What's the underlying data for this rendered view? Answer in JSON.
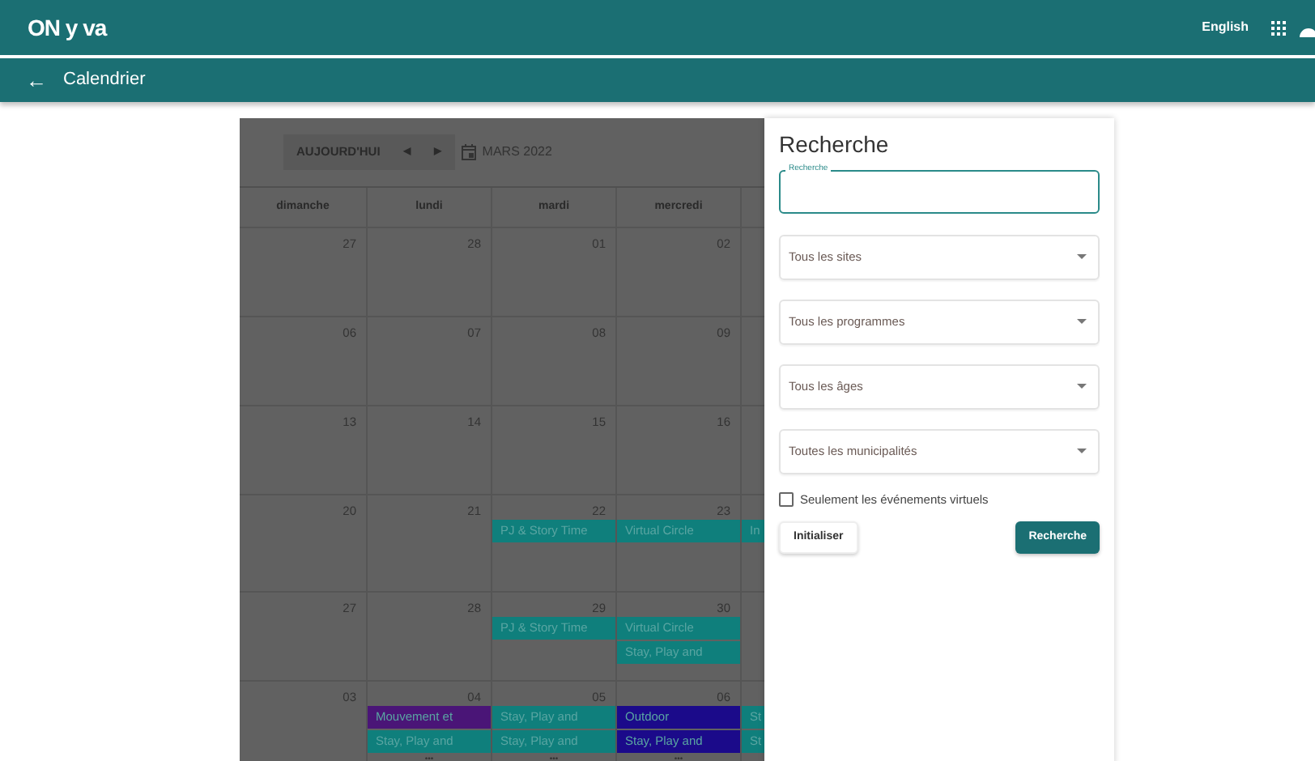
{
  "header": {
    "logo": "ON y va",
    "language": "English"
  },
  "subbar": {
    "back": "←",
    "title": "Calendrier"
  },
  "calendar": {
    "today_button": "AUJOURD'HUI",
    "prev": "◀",
    "next": "▶",
    "month_label": "MARS 2022",
    "weekdays": [
      "dimanche",
      "lundi",
      "mardi",
      "mercredi"
    ],
    "weeks": [
      {
        "days": [
          {
            "date": "27"
          },
          {
            "date": "28"
          },
          {
            "date": "01"
          },
          {
            "date": "02"
          }
        ]
      },
      {
        "days": [
          {
            "date": "06"
          },
          {
            "date": "07"
          },
          {
            "date": "08"
          },
          {
            "date": "09"
          }
        ]
      },
      {
        "days": [
          {
            "date": "13"
          },
          {
            "date": "14"
          },
          {
            "date": "15"
          },
          {
            "date": "16"
          }
        ]
      },
      {
        "days": [
          {
            "date": "20"
          },
          {
            "date": "21"
          },
          {
            "date": "22",
            "events": [
              {
                "title": "PJ & Story Time",
                "color": "#0f7f7c"
              }
            ]
          },
          {
            "date": "23",
            "events": [
              {
                "title": "Virtual Circle",
                "color": "#0f7f7c"
              }
            ]
          },
          {
            "events": [
              {
                "title": "In",
                "color": "#0f7f7c"
              }
            ]
          }
        ]
      },
      {
        "days": [
          {
            "date": "27"
          },
          {
            "date": "28"
          },
          {
            "date": "29",
            "events": [
              {
                "title": "PJ & Story Time",
                "color": "#0f7f7c"
              }
            ]
          },
          {
            "date": "30",
            "events": [
              {
                "title": "Virtual Circle",
                "color": "#0f7f7c"
              },
              {
                "title": "Stay, Play and",
                "color": "#0f7f7c"
              }
            ]
          }
        ]
      },
      {
        "days": [
          {
            "date": "03"
          },
          {
            "date": "04",
            "events": [
              {
                "title": "Mouvement et",
                "color": "#4a1577"
              },
              {
                "title": "Stay, Play and",
                "color": "#0f7f7c"
              }
            ],
            "more": "•••"
          },
          {
            "date": "05",
            "events": [
              {
                "title": "Stay, Play and",
                "color": "#0f7f7c"
              },
              {
                "title": "Stay, Play and",
                "color": "#0f7f7c"
              }
            ],
            "more": "•••"
          },
          {
            "date": "06",
            "events": [
              {
                "title": "Outdoor",
                "color": "#1b0a8a"
              },
              {
                "title": "Stay, Play and",
                "color": "#1b0a8a"
              }
            ],
            "more": "•••"
          },
          {
            "events": [
              {
                "title": "St",
                "color": "#0f7f7c"
              },
              {
                "title": "St",
                "color": "#0f7f7c"
              }
            ]
          }
        ]
      }
    ]
  },
  "drawer": {
    "title": "Recherche",
    "search": {
      "label": "Recherche"
    },
    "filters": [
      {
        "placeholder": "Tous les sites"
      },
      {
        "placeholder": "Tous les programmes"
      },
      {
        "placeholder": "Tous les âges"
      },
      {
        "placeholder": "Toutes les municipalités"
      }
    ],
    "virtual_only": {
      "label": "Seulement les événements virtuels",
      "checked": false
    },
    "buttons": [
      {
        "label": "Initialiser",
        "kind": "secondary"
      },
      {
        "label": "Recherche",
        "kind": "primary"
      }
    ]
  }
}
